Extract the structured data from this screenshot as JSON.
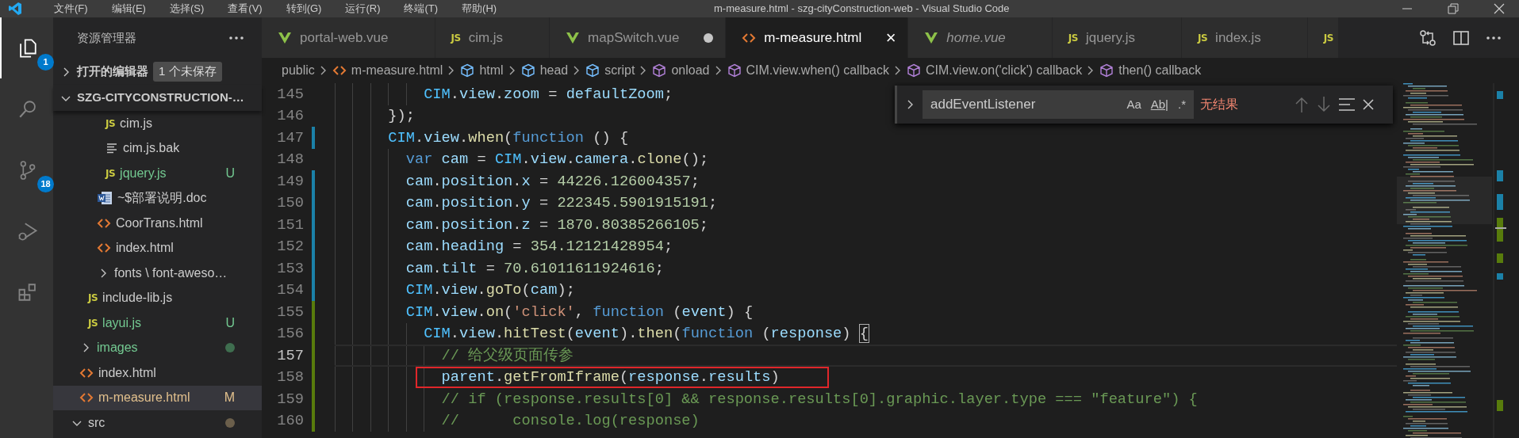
{
  "title_bar": {
    "menus": [
      "文件(F)",
      "编辑(E)",
      "选择(S)",
      "查看(V)",
      "转到(G)",
      "运行(R)",
      "终端(T)",
      "帮助(H)"
    ],
    "title": "m-measure.html - szg-cityConstruction-web - Visual Studio Code"
  },
  "activity_bar": [
    {
      "kind": "explorer",
      "selected": true,
      "badge": "1"
    },
    {
      "kind": "search",
      "selected": false
    },
    {
      "kind": "source-control",
      "selected": false,
      "badge": "18"
    },
    {
      "kind": "run-debug",
      "selected": false
    },
    {
      "kind": "extensions",
      "selected": false
    }
  ],
  "sidebar": {
    "title": "资源管理器",
    "open_editors": {
      "label": "打开的编辑器",
      "expanded": false,
      "badge": "1 个未保存"
    },
    "project": {
      "label": "SZG-CITYCONSTRUCTION-…",
      "expanded": true
    },
    "tree": [
      {
        "children": [
          {
            "children": [
              {
                "children": [
                  {
                    "children": [
                      {
                        "kind": "file",
                        "icon": {
                          "kind": "js",
                          "text": "JS"
                        },
                        "label": "cim.js",
                        "untracked": false,
                        "modified": false,
                        "selected": false
                      },
                      {
                        "kind": "file",
                        "icon": {
                          "kind": "text"
                        },
                        "label": "cim.js.bak",
                        "untracked": false,
                        "modified": false,
                        "selected": false
                      },
                      {
                        "kind": "file",
                        "icon": {
                          "kind": "js",
                          "text": "JS"
                        },
                        "label": "jquery.js",
                        "untracked": true,
                        "modified": false,
                        "badge": "U",
                        "selected": false
                      }
                    ]
                  },
                  {
                    "kind": "file",
                    "icon": {
                      "kind": "doc"
                    },
                    "label": "~$部署说明.doc",
                    "untracked": false,
                    "modified": false,
                    "selected": false
                  },
                  {
                    "kind": "file",
                    "icon": {
                      "kind": "html"
                    },
                    "label": "CoorTrans.html",
                    "untracked": false,
                    "modified": false,
                    "selected": false
                  },
                  {
                    "kind": "file",
                    "icon": {
                      "kind": "html"
                    },
                    "label": "index.html",
                    "untracked": false,
                    "modified": false,
                    "selected": false
                  },
                  {
                    "kind": "folder",
                    "label": "fonts \\ font-aweso…",
                    "expanded": false,
                    "untracked": false,
                    "modified": false,
                    "selected": false
                  }
                ]
              },
              {
                "kind": "file",
                "icon": {
                  "kind": "js",
                  "text": "JS"
                },
                "label": "include-lib.js",
                "untracked": false,
                "modified": false,
                "selected": false
              },
              {
                "kind": "file",
                "icon": {
                  "kind": "js",
                  "text": "JS"
                },
                "label": "layui.js",
                "untracked": true,
                "modified": false,
                "badge": "U",
                "selected": false
              }
            ]
          },
          {
            "kind": "folder",
            "label": "images",
            "expanded": false,
            "untracked": true,
            "modified": false,
            "selected": false
          },
          {
            "kind": "file",
            "icon": {
              "kind": "html"
            },
            "label": "index.html",
            "untracked": false,
            "modified": false,
            "selected": false
          },
          {
            "kind": "file",
            "icon": {
              "kind": "html"
            },
            "label": "m-measure.html",
            "untracked": false,
            "modified": true,
            "badge": "M",
            "selected": true
          }
        ]
      },
      {
        "kind": "folder",
        "label": "src",
        "expanded": true,
        "untracked": false,
        "modified": true,
        "selected": false
      }
    ]
  },
  "tabs": [
    {
      "label": "portal-web.vue",
      "icon": {
        "kind": "vue"
      },
      "selected": false,
      "dirty": false,
      "preview": false
    },
    {
      "label": "cim.js",
      "icon": {
        "kind": "js",
        "text": "JS"
      },
      "selected": false,
      "dirty": false,
      "preview": false
    },
    {
      "label": "mapSwitch.vue",
      "icon": {
        "kind": "vue"
      },
      "selected": false,
      "dirty": true,
      "preview": false
    },
    {
      "label": "m-measure.html",
      "icon": {
        "kind": "html"
      },
      "selected": true,
      "dirty": false,
      "preview": false,
      "close": "×"
    },
    {
      "label": "home.vue",
      "icon": {
        "kind": "vue"
      },
      "selected": false,
      "dirty": false,
      "preview": true
    },
    {
      "label": "jquery.js",
      "icon": {
        "kind": "js",
        "text": "JS"
      },
      "selected": false,
      "dirty": false,
      "preview": false
    },
    {
      "label": "index.js",
      "icon": {
        "kind": "js",
        "text": "JS"
      },
      "selected": false,
      "dirty": false,
      "preview": false
    },
    {
      "icon": {
        "kind": "js",
        "text": "JS"
      },
      "selected": false
    }
  ],
  "breadcrumbs": [
    {
      "label": "public",
      "kind": "folder"
    },
    {
      "label": "m-measure.html",
      "kind": "html"
    },
    {
      "label": "html",
      "kind": "element"
    },
    {
      "label": "head",
      "kind": "element"
    },
    {
      "label": "script",
      "kind": "element"
    },
    {
      "label": "onload",
      "kind": "method"
    },
    {
      "label": "CIM.view.when() callback",
      "kind": "method"
    },
    {
      "label": "CIM.view.on('click') callback",
      "kind": "method"
    },
    {
      "label": "then() callback",
      "kind": "method"
    }
  ],
  "find_widget": {
    "expanded": false,
    "value": "addEventListener",
    "options": [
      {
        "label": "Aa",
        "on": false
      },
      {
        "label": "Ab|",
        "on": false
      },
      {
        "label": ".*",
        "on": false
      }
    ],
    "result": "无结果",
    "no_results": true
  },
  "code": [
    {
      "number": "145",
      "text": "          CIM.view.zoom = defaultZoom;",
      "kind": "plain",
      "current": false
    },
    {
      "number": "146",
      "text": "      });",
      "kind": "plain",
      "current": false
    },
    {
      "number": "147",
      "text": "      CIM.view.when(function () {",
      "kind": "modified",
      "current": false
    },
    {
      "number": "148",
      "text": "        var cam = CIM.view.camera.clone();",
      "kind": "plain",
      "current": false
    },
    {
      "number": "149",
      "text": "        cam.position.x = 44226.126004357;",
      "kind": "modified",
      "current": false
    },
    {
      "number": "150",
      "text": "        cam.position.y = 222345.5901915191;",
      "kind": "modified",
      "current": false
    },
    {
      "number": "151",
      "text": "        cam.position.z = 1870.80385266105;",
      "kind": "modified",
      "current": false
    },
    {
      "number": "152",
      "text": "        cam.heading = 354.12121428954;",
      "kind": "modified",
      "current": false
    },
    {
      "number": "153",
      "text": "        cam.tilt = 70.61011611924616;",
      "kind": "modified",
      "current": false
    },
    {
      "number": "154",
      "text": "        CIM.view.goTo(cam);",
      "kind": "modified",
      "current": false
    },
    {
      "number": "155",
      "text": "        CIM.view.on('click', function (event) {",
      "kind": "added",
      "current": false
    },
    {
      "number": "156",
      "text": "          CIM.view.hitTest(event).then(function (response) {",
      "kind": "added",
      "current": false,
      "bracket_match": true
    },
    {
      "number": "157",
      "text": "            // 给父级页面传参",
      "kind": "added",
      "current": true
    },
    {
      "number": "158",
      "text": "            parent.getFromIframe(response.results)",
      "kind": "added",
      "current": false,
      "boxed": true
    },
    {
      "number": "159",
      "text": "            // if (response.results[0] && response.results[0].graphic.layer.type === \"feature\") {",
      "kind": "added",
      "current": false
    },
    {
      "number": "160",
      "text": "            //      console.log(response)",
      "kind": "added",
      "current": false
    }
  ]
}
